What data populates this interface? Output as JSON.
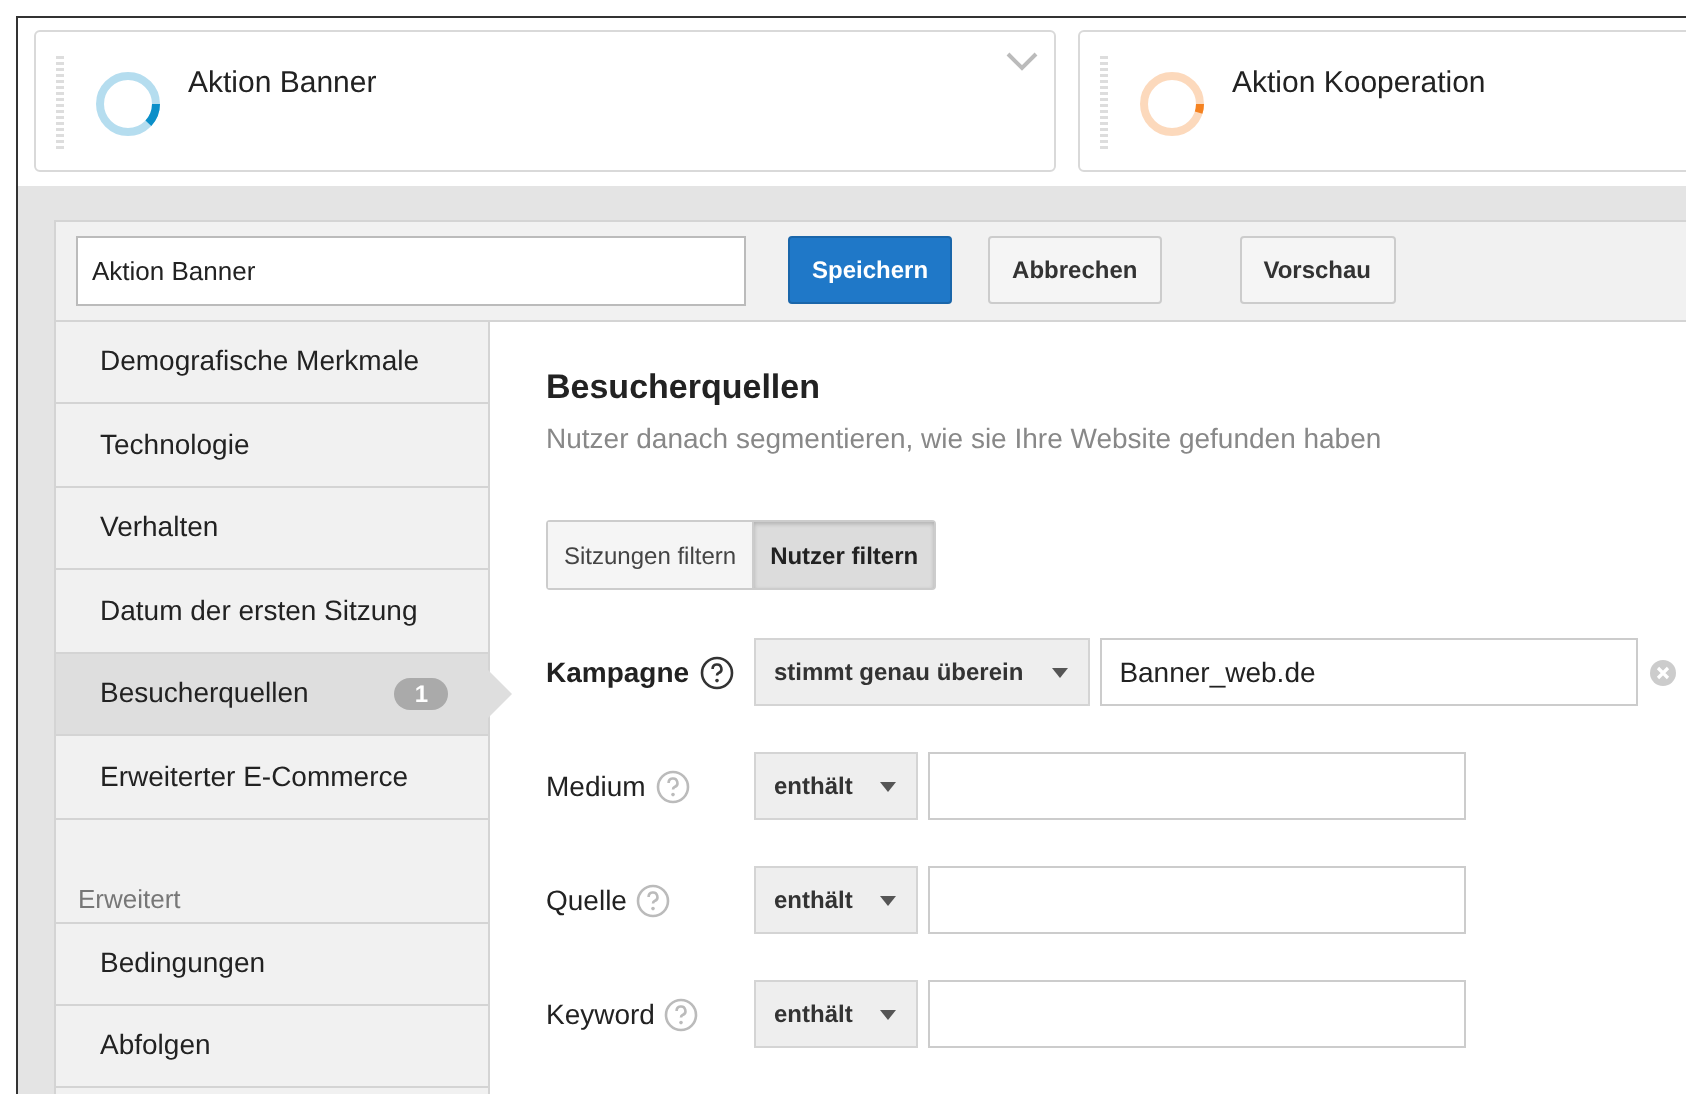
{
  "segments": [
    {
      "name": "Aktion Banner",
      "color": "#0b8fc9",
      "level": 0.12,
      "has_menu": true
    },
    {
      "name": "Aktion Kooperation",
      "color": "#f58220",
      "level": 0.05
    }
  ],
  "editor": {
    "name_field": {
      "value": "Aktion Banner"
    },
    "buttons": [
      {
        "label": "Speichern",
        "kind": "primary"
      },
      {
        "label": "Abbrechen",
        "kind": "secondary"
      },
      {
        "label": "Vorschau",
        "kind": "secondary"
      }
    ]
  },
  "sidebar": {
    "sections": [
      {
        "items": [
          {
            "label": "Demografische Merkmale",
            "selected": false
          },
          {
            "label": "Technologie",
            "selected": false
          },
          {
            "label": "Verhalten",
            "selected": false
          },
          {
            "label": "Datum der ersten Sitzung",
            "selected": false
          },
          {
            "label": "Besucherquellen",
            "selected": true,
            "badge": "1"
          },
          {
            "label": "Erweiterter E-Commerce",
            "selected": false
          }
        ]
      },
      {
        "heading": "Erweitert",
        "items": [
          {
            "label": "Bedingungen",
            "selected": false
          },
          {
            "label": "Abfolgen",
            "selected": false
          }
        ]
      }
    ]
  },
  "content": {
    "title": "Besucherquellen",
    "subtitle": "Nutzer danach segmentieren, wie sie Ihre Website gefunden haben",
    "scope_tabs": [
      {
        "label": "Sitzungen filtern",
        "selected": false
      },
      {
        "label": "Nutzer filtern",
        "selected": true
      }
    ],
    "filters": [
      {
        "label": "Kampagne",
        "active": true,
        "operator": "stimmt genau überein",
        "value": "Banner_web.de"
      },
      {
        "label": "Medium",
        "active": false,
        "operator": "enthält"
      },
      {
        "label": "Quelle",
        "active": false,
        "operator": "enthält"
      },
      {
        "label": "Keyword",
        "active": false,
        "operator": "enthält"
      }
    ]
  }
}
